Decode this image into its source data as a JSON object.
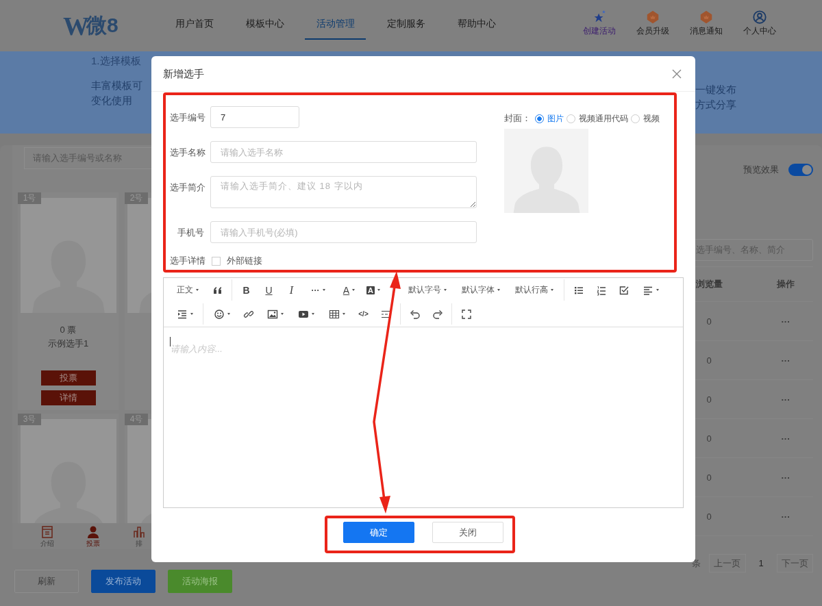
{
  "header": {
    "logo": {
      "mark": "W",
      "text": "微8"
    },
    "nav": [
      {
        "label": "用户首页",
        "selected": false
      },
      {
        "label": "模板中心",
        "selected": false
      },
      {
        "label": "活动管理",
        "selected": true
      },
      {
        "label": "定制服务",
        "selected": false
      },
      {
        "label": "帮助中心",
        "selected": false
      }
    ],
    "actions": [
      {
        "label": "创建活动",
        "kind": "stars"
      },
      {
        "label": "会员升级",
        "kind": "badge"
      },
      {
        "label": "消息通知",
        "kind": "badge"
      },
      {
        "label": "个人中心",
        "kind": "user"
      }
    ]
  },
  "banner": {
    "left": {
      "step": "1.选择模板",
      "lines": [
        "丰富模板可",
        "变化使用"
      ]
    },
    "right": {
      "lines": [
        "一键发布",
        "方式分享"
      ]
    }
  },
  "preview": {
    "search_placeholder": "请输入选手编号或名称",
    "contestants": [
      {
        "number": "1号",
        "votes": "0 票",
        "name": "示例选手1",
        "buttons": [
          "投票",
          "详情"
        ]
      },
      {
        "number": "2号"
      },
      {
        "number": "3号"
      },
      {
        "number": "4号"
      }
    ],
    "tabbar": [
      {
        "label": "介绍",
        "kind": "doc",
        "selected": false
      },
      {
        "label": "投票",
        "kind": "user",
        "selected": true
      },
      {
        "label": "排",
        "kind": "chart",
        "selected": false
      }
    ]
  },
  "page_buttons": [
    {
      "label": "刷新",
      "kind": "default"
    },
    {
      "label": "发布活动",
      "kind": "primary"
    },
    {
      "label": "活动海报",
      "kind": "success"
    }
  ],
  "right_panel": {
    "toggle": {
      "label": "预览效果",
      "on": true
    },
    "search_placeholder": "选手编号、名称、简介",
    "columns": [
      "浏览量",
      "操作"
    ],
    "rows": [
      {
        "views": "0",
        "actions": "···"
      },
      {
        "views": "0",
        "actions": "···"
      },
      {
        "views": "0",
        "actions": "···"
      },
      {
        "views": "0",
        "actions": "···"
      },
      {
        "views": "0",
        "actions": "···"
      },
      {
        "views": "0",
        "actions": "···"
      }
    ],
    "pagination": {
      "summary": "条",
      "prev": "上一页",
      "page": "1",
      "next": "下一页"
    }
  },
  "dialog": {
    "title": "新增选手",
    "fields": [
      {
        "kind": "input",
        "label": "选手编号",
        "value": "7"
      },
      {
        "kind": "input",
        "label": "选手名称",
        "placeholder": "请输入选手名称"
      },
      {
        "kind": "textarea",
        "label": "选手简介",
        "placeholder": "请输入选手简介、建议 18 字以内"
      },
      {
        "kind": "input",
        "label": "手机号",
        "placeholder": "请输入手机号(必填)"
      },
      {
        "kind": "checkbox",
        "label": "选手详情",
        "option": "外部链接",
        "checked": false
      }
    ],
    "cover": {
      "label": "封面：",
      "options": [
        {
          "label": "图片",
          "selected": true
        },
        {
          "label": "视频通用代码",
          "selected": false
        },
        {
          "label": "视频",
          "selected": false
        }
      ]
    },
    "editor": {
      "toolbar": [
        [
          [
            {
              "kind": "label",
              "label": "正文",
              "caret": true
            },
            {
              "kind": "icon",
              "caret": false
            }
          ],
          [
            {
              "kind": "bold",
              "text": "B",
              "caret": false
            },
            {
              "kind": "underline",
              "text": "U",
              "caret": false
            },
            {
              "kind": "italic",
              "text": "I",
              "caret": false
            },
            {
              "kind": "more",
              "text": "···",
              "caret": true
            },
            {
              "kind": "color",
              "text": "A",
              "caret": true
            },
            {
              "kind": "highlight",
              "text": "A",
              "caret": true
            }
          ],
          [
            {
              "kind": "label",
              "label": "默认字号",
              "caret": true
            },
            {
              "kind": "label",
              "label": "默认字体",
              "caret": true
            },
            {
              "kind": "label",
              "label": "默认行高",
              "caret": true
            }
          ],
          [
            {
              "kind": "icon",
              "caret": false
            },
            {
              "kind": "icon",
              "caret": false
            },
            {
              "kind": "icon",
              "caret": false
            },
            {
              "kind": "icon",
              "caret": true
            }
          ]
        ],
        [
          [
            {
              "kind": "icon",
              "caret": true
            }
          ],
          [
            {
              "kind": "icon",
              "caret": true
            },
            {
              "kind": "icon",
              "caret": false
            },
            {
              "kind": "icon",
              "caret": true
            },
            {
              "kind": "icon",
              "caret": true
            },
            {
              "kind": "icon",
              "caret": true
            },
            {
              "kind": "code",
              "text": "</>",
              "caret": false
            },
            {
              "kind": "icon",
              "caret": false
            }
          ],
          [
            {
              "kind": "icon",
              "caret": false
            },
            {
              "kind": "icon",
              "caret": false
            }
          ],
          [
            {
              "kind": "icon",
              "caret": false
            }
          ]
        ]
      ],
      "placeholder": "请输入内容..."
    },
    "buttons": [
      {
        "label": "确定",
        "kind": "primary"
      },
      {
        "label": "关闭",
        "kind": "default"
      }
    ]
  },
  "annotations": [
    {
      "kind": "box"
    },
    {
      "kind": "box"
    },
    {
      "kind": "double-arrow"
    }
  ]
}
